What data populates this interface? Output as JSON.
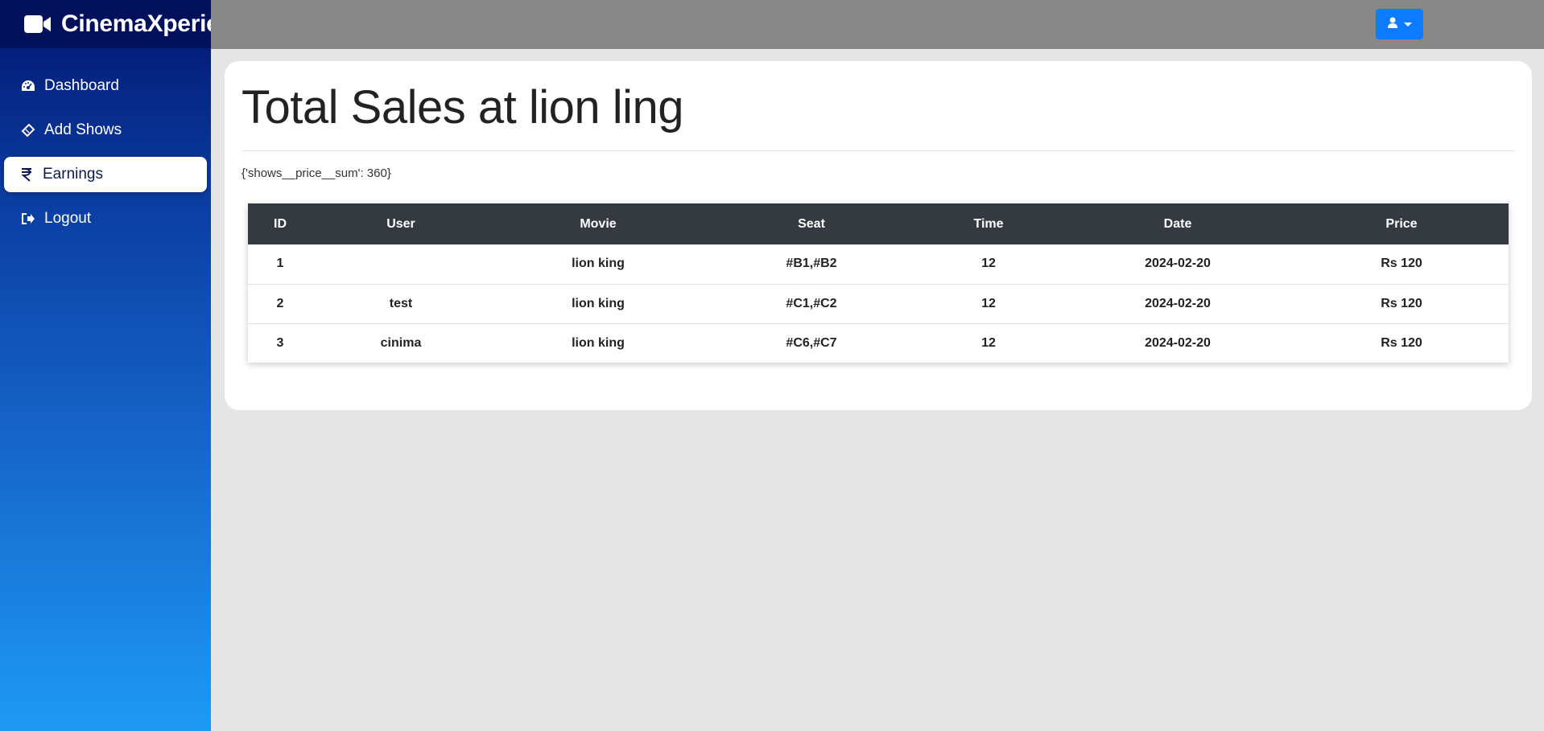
{
  "brand": {
    "name": "CinemaXperience",
    "icon": "video-camera-icon"
  },
  "sidebar": {
    "items": [
      {
        "label": "Dashboard",
        "icon": "dashboard-gauge-icon",
        "active": false
      },
      {
        "label": "Add Shows",
        "icon": "ticket-icon",
        "active": false
      },
      {
        "label": "Earnings",
        "icon": "rupee-icon",
        "active": true
      },
      {
        "label": "Logout",
        "icon": "logout-icon",
        "active": false
      }
    ]
  },
  "topbar": {
    "user_menu_icon": "user-icon"
  },
  "main": {
    "title": "Total Sales at lion ling",
    "sum_text": "{'shows__price__sum': 360}",
    "table": {
      "headers": [
        "ID",
        "User",
        "Movie",
        "Seat",
        "Time",
        "Date",
        "Price"
      ],
      "rows": [
        [
          "1",
          "",
          "lion king",
          "#B1,#B2",
          "12",
          "2024-02-20",
          "Rs 120"
        ],
        [
          "2",
          "test",
          "lion king",
          "#C1,#C2",
          "12",
          "2024-02-20",
          "Rs 120"
        ],
        [
          "3",
          "cinima",
          "lion king",
          "#C6,#C7",
          "12",
          "2024-02-20",
          "Rs 120"
        ]
      ]
    }
  },
  "colors": {
    "topbar": "#878787",
    "accent_button": "#0d7bff",
    "table_header": "#343a40",
    "sidebar_top": "#02156e",
    "sidebar_bottom": "#1e9af5"
  }
}
